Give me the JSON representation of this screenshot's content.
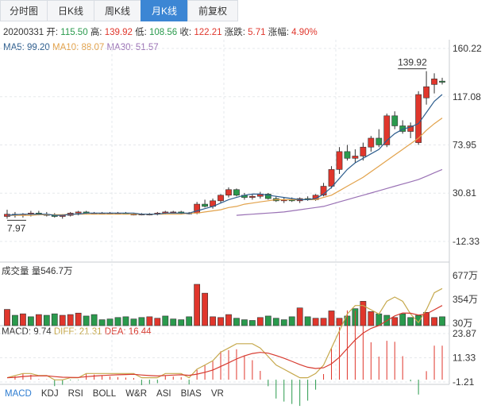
{
  "tabs": [
    "分时图",
    "日K线",
    "周K线",
    "月K线",
    "前复权"
  ],
  "active_tab": 3,
  "info": {
    "date": "20200331",
    "open_label": "开:",
    "open": "115.50",
    "high_label": "高:",
    "high": "139.92",
    "low_label": "低:",
    "low": "108.56",
    "close_label": "收:",
    "close": "122.21",
    "chg_label": "涨跌:",
    "chg": "5.71",
    "pct_label": "涨幅:",
    "pct": "4.90%"
  },
  "ma": {
    "ma5": "MA5: 99.20",
    "ma10": "MA10: 88.07",
    "ma30": "MA30: 51.57"
  },
  "volume": {
    "label": "成交量",
    "value": "量546.7万"
  },
  "macd": {
    "macd": "MACD: 9.74",
    "diff": "DIFF: 21.31",
    "dea": "DEA: 16.44"
  },
  "indicators": [
    "MACD",
    "KDJ",
    "RSI",
    "BOLL",
    "W&R",
    "ASI",
    "BIAS",
    "VR"
  ],
  "colors": {
    "up": "#e0362c",
    "down": "#2a9a4d",
    "ma5": "#2e5e8e",
    "ma10": "#e2a24b",
    "ma30": "#9a72b5",
    "diff": "#c6a94d",
    "dea": "#d73a2f",
    "tab_active": "#3c86d4"
  },
  "chart_data": [
    {
      "type": "candlestick",
      "y_axis_labels": [
        "160.22",
        "117.08",
        "73.95",
        "30.81",
        "-12.33"
      ],
      "ylim": [
        -12.33,
        160.22
      ],
      "high_label": "139.92",
      "low_label": "7.97",
      "candles": [
        {
          "o": 10,
          "h": 16,
          "l": 8,
          "c": 12
        },
        {
          "o": 12,
          "h": 14,
          "l": 9,
          "c": 11
        },
        {
          "o": 11,
          "h": 13,
          "l": 9,
          "c": 12
        },
        {
          "o": 12,
          "h": 15,
          "l": 10,
          "c": 13
        },
        {
          "o": 13,
          "h": 15,
          "l": 11,
          "c": 12
        },
        {
          "o": 12,
          "h": 14,
          "l": 10,
          "c": 11
        },
        {
          "o": 11,
          "h": 13,
          "l": 9,
          "c": 10
        },
        {
          "o": 10,
          "h": 12,
          "l": 8,
          "c": 11
        },
        {
          "o": 11,
          "h": 14,
          "l": 10,
          "c": 13
        },
        {
          "o": 13,
          "h": 15,
          "l": 11,
          "c": 14
        },
        {
          "o": 14,
          "h": 15,
          "l": 12,
          "c": 13
        },
        {
          "o": 13,
          "h": 14,
          "l": 12,
          "c": 13
        },
        {
          "o": 13,
          "h": 14,
          "l": 12,
          "c": 13
        },
        {
          "o": 13,
          "h": 14,
          "l": 12,
          "c": 13
        },
        {
          "o": 13,
          "h": 14,
          "l": 12,
          "c": 13
        },
        {
          "o": 13,
          "h": 14,
          "l": 12,
          "c": 12
        },
        {
          "o": 12,
          "h": 13,
          "l": 11,
          "c": 12
        },
        {
          "o": 12,
          "h": 13,
          "l": 11,
          "c": 12
        },
        {
          "o": 12,
          "h": 13,
          "l": 11,
          "c": 12
        },
        {
          "o": 12,
          "h": 14,
          "l": 11,
          "c": 13
        },
        {
          "o": 13,
          "h": 15,
          "l": 12,
          "c": 14
        },
        {
          "o": 14,
          "h": 15,
          "l": 13,
          "c": 14
        },
        {
          "o": 14,
          "h": 15,
          "l": 12,
          "c": 13
        },
        {
          "o": 13,
          "h": 14,
          "l": 12,
          "c": 13
        },
        {
          "o": 13,
          "h": 23,
          "l": 12,
          "c": 21
        },
        {
          "o": 21,
          "h": 25,
          "l": 18,
          "c": 19
        },
        {
          "o": 19,
          "h": 26,
          "l": 17,
          "c": 24
        },
        {
          "o": 24,
          "h": 30,
          "l": 22,
          "c": 29
        },
        {
          "o": 29,
          "h": 36,
          "l": 27,
          "c": 34
        },
        {
          "o": 34,
          "h": 35,
          "l": 28,
          "c": 29
        },
        {
          "o": 29,
          "h": 31,
          "l": 25,
          "c": 27
        },
        {
          "o": 27,
          "h": 30,
          "l": 25,
          "c": 28
        },
        {
          "o": 28,
          "h": 32,
          "l": 26,
          "c": 30
        },
        {
          "o": 30,
          "h": 31,
          "l": 25,
          "c": 26
        },
        {
          "o": 26,
          "h": 28,
          "l": 23,
          "c": 24
        },
        {
          "o": 24,
          "h": 27,
          "l": 22,
          "c": 25
        },
        {
          "o": 25,
          "h": 27,
          "l": 23,
          "c": 24
        },
        {
          "o": 24,
          "h": 27,
          "l": 22,
          "c": 26
        },
        {
          "o": 26,
          "h": 28,
          "l": 24,
          "c": 25
        },
        {
          "o": 25,
          "h": 30,
          "l": 24,
          "c": 29
        },
        {
          "o": 29,
          "h": 40,
          "l": 28,
          "c": 37
        },
        {
          "o": 37,
          "h": 55,
          "l": 35,
          "c": 52
        },
        {
          "o": 52,
          "h": 72,
          "l": 48,
          "c": 68
        },
        {
          "o": 68,
          "h": 74,
          "l": 60,
          "c": 62
        },
        {
          "o": 62,
          "h": 70,
          "l": 58,
          "c": 64
        },
        {
          "o": 64,
          "h": 76,
          "l": 60,
          "c": 72
        },
        {
          "o": 72,
          "h": 82,
          "l": 68,
          "c": 80
        },
        {
          "o": 80,
          "h": 88,
          "l": 72,
          "c": 74
        },
        {
          "o": 74,
          "h": 102,
          "l": 72,
          "c": 100
        },
        {
          "o": 100,
          "h": 104,
          "l": 88,
          "c": 91
        },
        {
          "o": 91,
          "h": 96,
          "l": 84,
          "c": 86
        },
        {
          "o": 86,
          "h": 94,
          "l": 80,
          "c": 91
        },
        {
          "o": 76,
          "h": 122,
          "l": 74,
          "c": 119
        },
        {
          "o": 116,
          "h": 139.92,
          "l": 110,
          "c": 126
        },
        {
          "o": 128,
          "h": 138,
          "l": 120,
          "c": 133
        },
        {
          "o": 131,
          "h": 134,
          "l": 128,
          "c": 130
        }
      ],
      "ma5": [
        11,
        11.5,
        12,
        12,
        12,
        12,
        11,
        11,
        12,
        12,
        13,
        13,
        13,
        13,
        13,
        13,
        13,
        12,
        12,
        12,
        13,
        13,
        13,
        13,
        15,
        17,
        19,
        22,
        25,
        27,
        29,
        30,
        30,
        29,
        28,
        27,
        26,
        25,
        25,
        26,
        30,
        36,
        44,
        52,
        58,
        62,
        66,
        70,
        78,
        84,
        88,
        90,
        93,
        103,
        113,
        119
      ],
      "ma10": [
        11,
        11,
        11,
        11,
        11.5,
        11.5,
        11.5,
        11.5,
        12,
        12,
        12,
        12,
        12,
        12,
        12,
        12,
        12,
        12,
        12,
        12,
        12,
        12,
        12,
        13,
        13,
        14,
        15,
        16,
        18,
        19,
        21,
        22,
        23,
        24,
        25,
        25,
        25,
        25,
        25,
        25,
        27,
        29,
        33,
        37,
        41,
        45,
        50,
        55,
        60,
        65,
        70,
        75,
        80,
        87,
        93,
        98
      ],
      "ma30": [
        null,
        null,
        null,
        null,
        null,
        null,
        null,
        null,
        null,
        null,
        null,
        null,
        null,
        null,
        null,
        null,
        null,
        null,
        null,
        null,
        null,
        null,
        null,
        null,
        null,
        null,
        null,
        null,
        null,
        11,
        11.5,
        12,
        12.5,
        13,
        13.5,
        14,
        15,
        16,
        17,
        18,
        19,
        21,
        23,
        25,
        27,
        29,
        31,
        33,
        35,
        37,
        39,
        41,
        43,
        46,
        49,
        52
      ]
    },
    {
      "type": "bar",
      "name": "volume",
      "y_axis_labels": [
        "677万",
        "354万",
        "30万"
      ],
      "ylim": [
        0,
        700
      ],
      "values": [
        220,
        140,
        160,
        120,
        150,
        140,
        160,
        140,
        150,
        170,
        130,
        150,
        80,
        90,
        110,
        120,
        90,
        110,
        120,
        100,
        130,
        90,
        80,
        120,
        560,
        440,
        120,
        110,
        150,
        100,
        80,
        70,
        110,
        130,
        100,
        80,
        120,
        240,
        120,
        100,
        100,
        200,
        100,
        130,
        230,
        330,
        190,
        160,
        140,
        110,
        160,
        110,
        140,
        180,
        110,
        120
      ],
      "directions": [
        "u",
        "d",
        "u",
        "d",
        "u",
        "d",
        "d",
        "u",
        "u",
        "u",
        "d",
        "d",
        "d",
        "d",
        "d",
        "d",
        "d",
        "d",
        "u",
        "u",
        "d",
        "d",
        "d",
        "d",
        "u",
        "u",
        "u",
        "u",
        "u",
        "d",
        "d",
        "d",
        "u",
        "d",
        "d",
        "d",
        "d",
        "u",
        "d",
        "u",
        "u",
        "u",
        "u",
        "d",
        "d",
        "u",
        "u",
        "d",
        "d",
        "u",
        "d",
        "d",
        "d",
        "u",
        "u",
        "d"
      ]
    },
    {
      "type": "macd",
      "y_axis_labels": [
        "23.87",
        "11.33",
        "-1.21"
      ],
      "ylim": [
        -1.21,
        23.87
      ]
    }
  ]
}
